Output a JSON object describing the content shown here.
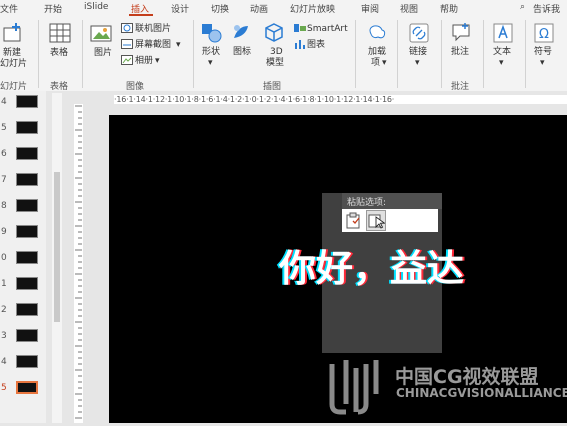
{
  "menu": {
    "file": "文件",
    "home": "开始",
    "islide": "iSlide",
    "insert": "插入",
    "design": "设计",
    "transitions": "切换",
    "animations": "动画",
    "slideshow": "幻灯片放映",
    "review": "审阅",
    "view": "视图",
    "help": "帮助",
    "tell_me": "告诉我"
  },
  "ribbon": {
    "new_slide_1": "新建",
    "new_slide_2": "幻灯片",
    "table": "表格",
    "slides_group": "幻灯片",
    "tables_group": "表格",
    "picture": "图片",
    "online_picture": "联机图片",
    "screenshot": "屏幕截图",
    "album": "相册",
    "images_group": "图像",
    "shapes": "形状",
    "icons": "图标",
    "model_1": "3D",
    "model_2": "模型",
    "smartart": "SmartArt",
    "chart": "图表",
    "illustrations_group": "插图",
    "addins_1": "加载",
    "addins_2": "项",
    "link": "链接",
    "comment": "批注",
    "comments_group": "批注",
    "text": "文本",
    "symbol": "符号"
  },
  "thumbnails": [
    "4",
    "5",
    "6",
    "7",
    "8",
    "9",
    "0",
    "1",
    "2",
    "3",
    "4",
    "5"
  ],
  "ruler_text": "·16·1·14·1·12·1·10·1·8·1·6·1·4·1·2·1·0·1·2·1·4·1·6·1·8·1·10·1·12·1·14·1·16·",
  "paste": {
    "title": "粘贴选项:"
  },
  "slide": {
    "text": "你好，益达"
  },
  "watermark": {
    "cn": "中国CG视效联盟",
    "en": "CHINACGVISIONALLIANCE"
  }
}
